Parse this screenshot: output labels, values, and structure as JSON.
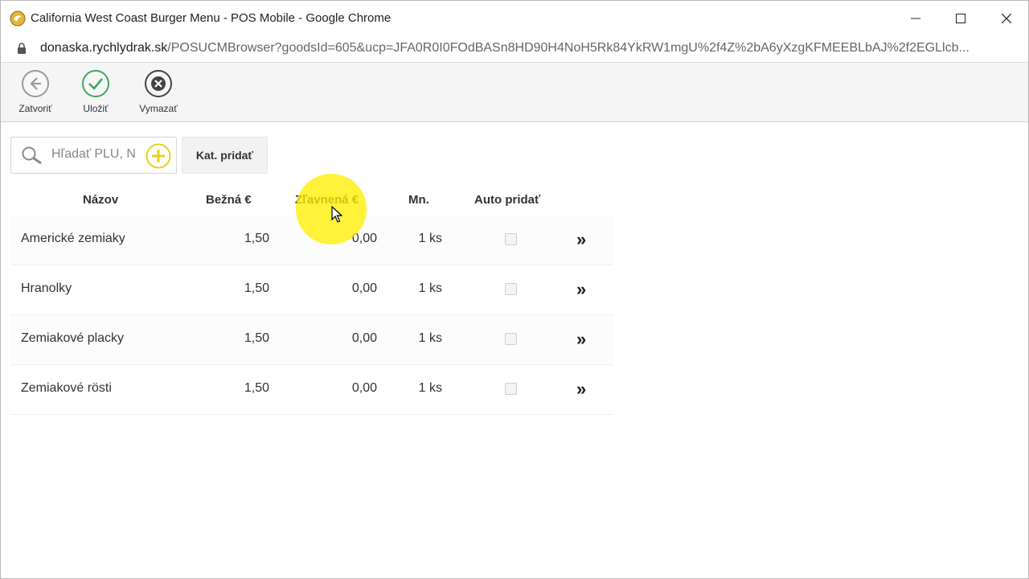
{
  "window": {
    "title": "California West Coast Burger Menu - POS Mobile - Google Chrome"
  },
  "address": {
    "host": "donaska.rychlydrak.sk",
    "path": "/POSUCMBrowser?goodsId=605&ucp=JFA0R0I0FOdBASn8HD90H4NoH5Rk84YkRW1mgU%2f4Z%2bA6yXzgKFMEEBLbAJ%2f2EGLlcb..."
  },
  "toolbar": {
    "close_label": "Zatvoriť",
    "save_label": "Uložiť",
    "delete_label": "Vymazať"
  },
  "search": {
    "placeholder": "Hľadať PLU, N",
    "value": ""
  },
  "kat_button_label": "Kat. pridať",
  "table": {
    "headers": {
      "name": "Názov",
      "price": "Bežná €",
      "discount": "Zľavnená €",
      "qty": "Mn.",
      "auto": "Auto pridať"
    },
    "rows": [
      {
        "name": "Americké zemiaky",
        "price": "1,50",
        "discount": "0,00",
        "qty": "1 ks",
        "auto": false,
        "chevron": "»"
      },
      {
        "name": "Hranolky",
        "price": "1,50",
        "discount": "0,00",
        "qty": "1 ks",
        "auto": false,
        "chevron": "»"
      },
      {
        "name": "Zemiakové placky",
        "price": "1,50",
        "discount": "0,00",
        "qty": "1 ks",
        "auto": false,
        "chevron": "»"
      },
      {
        "name": "Zemiakové rösti",
        "price": "1,50",
        "discount": "0,00",
        "qty": "1 ks",
        "auto": false,
        "chevron": "»"
      }
    ]
  },
  "colors": {
    "accent_green": "#3daa5a",
    "accent_yellow": "#e8d21c",
    "icon_grey": "#9a9a9a",
    "icon_dark": "#444444"
  },
  "icons": {
    "close": "arrow-left-circle-icon",
    "save": "check-circle-icon",
    "delete": "x-circle-icon",
    "search": "search-icon",
    "add": "plus-circle-icon",
    "row_action": "double-chevron-right-icon"
  }
}
